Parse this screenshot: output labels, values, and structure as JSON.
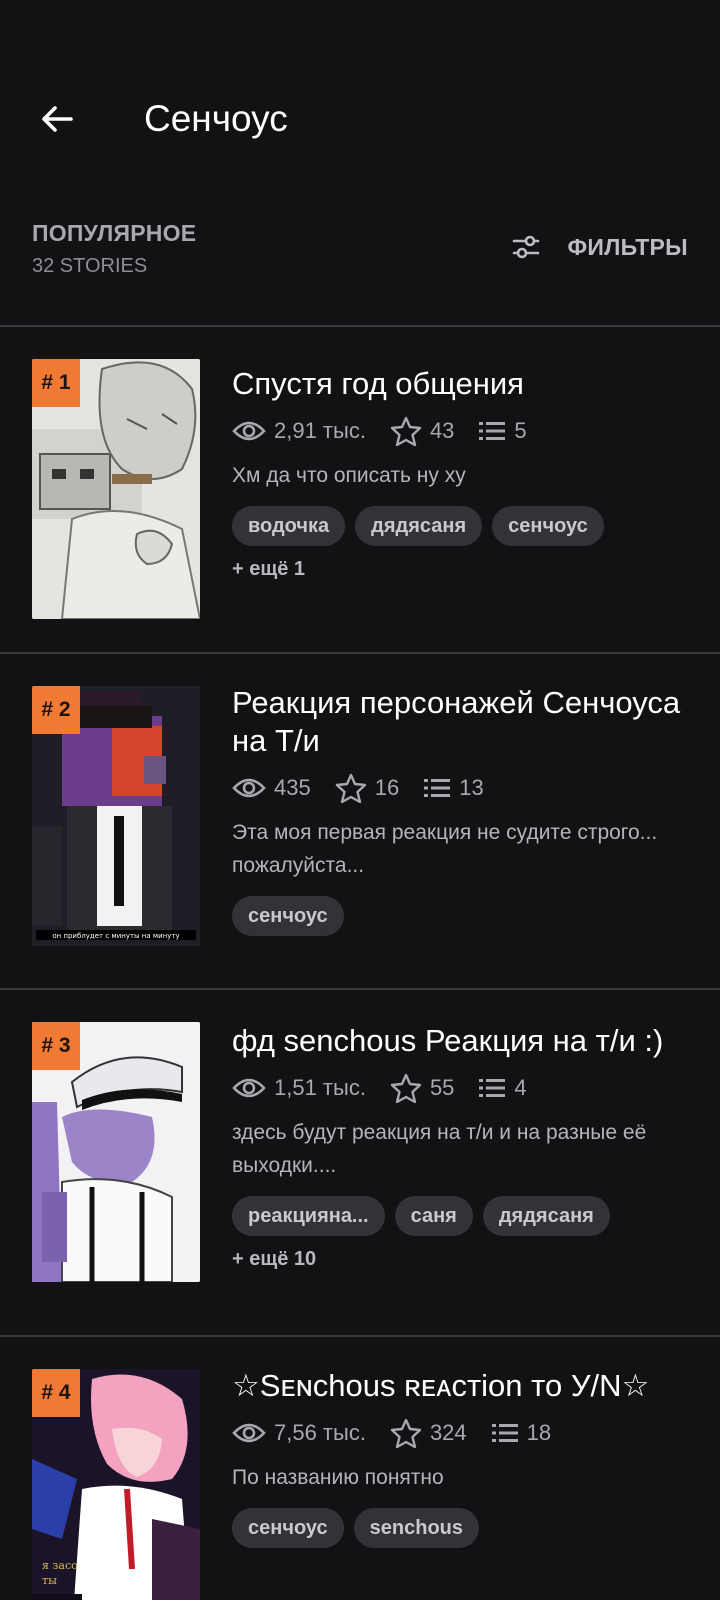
{
  "header": {
    "title": "Сенчоус",
    "back_icon": "back-arrow-icon"
  },
  "sort": {
    "label": "ПОПУЛЯРНОЕ",
    "count": "32 STORIES"
  },
  "filters": {
    "label": "ФИЛЬТРЫ",
    "icon": "sliders-icon"
  },
  "colors": {
    "background": "#121114",
    "rank_badge": "#f07a33",
    "tag_bg": "#333237",
    "divider": "#3a393d"
  },
  "stories": [
    {
      "rank": "# 1",
      "title": "Спустя год общения",
      "views": "2,91 тыс.",
      "votes": "43",
      "parts": "5",
      "description": "Хм да что описать ну ху",
      "tags": [
        "водочка",
        "дядясаня",
        "сенчоус"
      ],
      "more": "+ ещё 1"
    },
    {
      "rank": "# 2",
      "title": "Реакция персонажей Сенчоуса на Т/и",
      "views": "435",
      "votes": "16",
      "parts": "13",
      "description": "Эта моя первая реакция не судите строго... пожалуйста...",
      "tags": [
        "сенчоус"
      ],
      "more": ""
    },
    {
      "rank": "# 3",
      "title": "фд senchous Реакция на т/и :)",
      "views": "1,51 тыс.",
      "votes": "55",
      "parts": "4",
      "description": "здесь будут реакция на т/и и на разные её выходки....",
      "tags": [
        "реакцияна...",
        "саня",
        "дядясаня"
      ],
      "more": "+ ещё 10"
    },
    {
      "rank": "# 4",
      "title": "☆Sᴇɴchous ʀᴇᴀcтion то У/N☆",
      "views": "7,56 тыс.",
      "votes": "324",
      "parts": "18",
      "description": "По названию понятно",
      "tags": [
        "сенчоус",
        "senchous"
      ],
      "more": ""
    }
  ]
}
